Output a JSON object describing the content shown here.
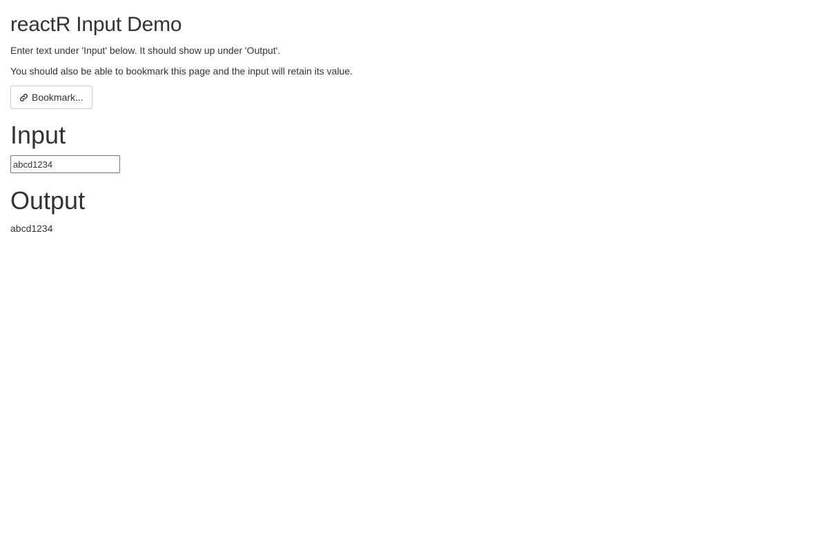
{
  "page": {
    "title": "reactR Input Demo",
    "description_1": "Enter text under 'Input' below. It should show up under 'Output'.",
    "description_2": "You should also be able to bookmark this page and the input will retain its value."
  },
  "bookmark_button": {
    "label": "Bookmark...",
    "icon": "link-icon"
  },
  "input_section": {
    "heading": "Input",
    "value": "abcd1234"
  },
  "output_section": {
    "heading": "Output",
    "value": "abcd1234"
  },
  "colors": {
    "text": "#333333",
    "button_border": "#cccccc",
    "input_border": "#767676",
    "background": "#ffffff"
  }
}
